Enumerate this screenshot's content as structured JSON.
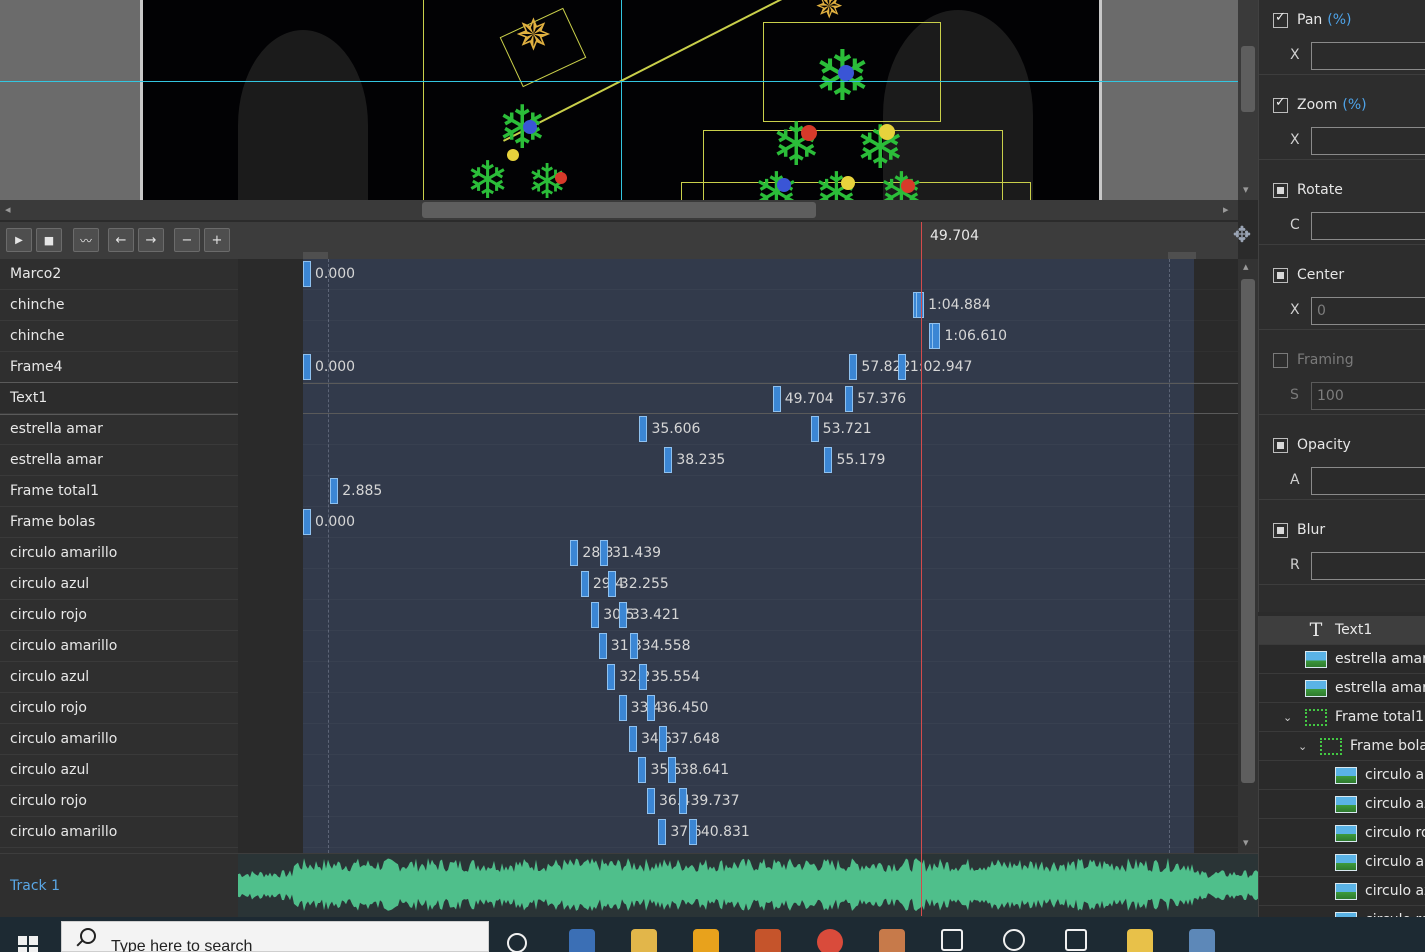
{
  "timeline": {
    "current_time": "49.704",
    "toolbar": {
      "play": "▶",
      "stop": "■",
      "waveform": "〰",
      "prev": "←",
      "next": "→",
      "zoom_out": "−",
      "zoom_in": "+"
    },
    "rows": [
      {
        "label": "Marco2",
        "keys": [
          {
            "t": 0.0,
            "text": "0.000"
          }
        ]
      },
      {
        "label": "chinche",
        "keys": [
          {
            "t": 64.5,
            "text": ""
          },
          {
            "t": 64.884,
            "text": "1:04.884"
          }
        ]
      },
      {
        "label": "chinche",
        "keys": [
          {
            "t": 66.2,
            "text": ""
          },
          {
            "t": 66.61,
            "text": "1:06.610"
          }
        ]
      },
      {
        "label": "Frame4",
        "keys": [
          {
            "t": 0.0,
            "text": "0.000"
          },
          {
            "t": 57.822,
            "text": "57.822"
          },
          {
            "t": 62.947,
            "text": "1:02.947"
          }
        ]
      },
      {
        "label": "Text1",
        "selected": true,
        "keys": [
          {
            "t": 49.704,
            "text": "49.704"
          },
          {
            "t": 57.376,
            "text": "57.376"
          }
        ]
      },
      {
        "label": "estrella amar",
        "keys": [
          {
            "t": 35.606,
            "text": "35.606"
          },
          {
            "t": 53.721,
            "text": "53.721"
          }
        ]
      },
      {
        "label": "estrella amar",
        "keys": [
          {
            "t": 38.235,
            "text": "38.235"
          },
          {
            "t": 55.179,
            "text": "55.179"
          }
        ]
      },
      {
        "label": "Frame total1",
        "keys": [
          {
            "t": 2.885,
            "text": "2.885"
          }
        ]
      },
      {
        "label": "Frame bolas",
        "keys": [
          {
            "t": 0.0,
            "text": "0.000"
          }
        ]
      },
      {
        "label": "circulo amarillo",
        "keys": [
          {
            "t": 28.3,
            "text": "28.3"
          },
          {
            "t": 31.439,
            "text": "31.439"
          }
        ]
      },
      {
        "label": "circulo azul",
        "keys": [
          {
            "t": 29.4,
            "text": "29.4"
          },
          {
            "t": 32.255,
            "text": "32.255"
          }
        ]
      },
      {
        "label": "circulo rojo",
        "keys": [
          {
            "t": 30.5,
            "text": "30.5"
          },
          {
            "t": 33.421,
            "text": "33.421"
          }
        ]
      },
      {
        "label": "circulo amarillo",
        "keys": [
          {
            "t": 31.3,
            "text": "31.3"
          },
          {
            "t": 34.558,
            "text": "34.558"
          }
        ]
      },
      {
        "label": "circulo azul",
        "keys": [
          {
            "t": 32.2,
            "text": "32.2"
          },
          {
            "t": 35.554,
            "text": "35.554"
          }
        ]
      },
      {
        "label": "circulo rojo",
        "keys": [
          {
            "t": 33.4,
            "text": "33.4"
          },
          {
            "t": 36.45,
            "text": "36.450"
          }
        ]
      },
      {
        "label": "circulo amarillo",
        "keys": [
          {
            "t": 34.5,
            "text": "34.5"
          },
          {
            "t": 37.648,
            "text": "37.648"
          }
        ]
      },
      {
        "label": "circulo azul",
        "keys": [
          {
            "t": 35.5,
            "text": "35.5"
          },
          {
            "t": 38.641,
            "text": "38.641"
          }
        ]
      },
      {
        "label": "circulo rojo",
        "keys": [
          {
            "t": 36.4,
            "text": "36.4"
          },
          {
            "t": 39.737,
            "text": "39.737"
          }
        ]
      },
      {
        "label": "circulo amarillo",
        "keys": [
          {
            "t": 37.6,
            "text": "37.6"
          },
          {
            "t": 40.831,
            "text": "40.831"
          }
        ]
      }
    ]
  },
  "audio": {
    "label": "Track 1",
    "color": "#4fbf8b"
  },
  "properties": [
    {
      "name": "Pan",
      "unit": "(%)",
      "state": "checked",
      "field_label": "X",
      "value": "",
      "disabled": false
    },
    {
      "name": "Zoom",
      "unit": "(%)",
      "state": "checked",
      "field_label": "X",
      "value": "",
      "disabled": false
    },
    {
      "name": "Rotate",
      "unit": "",
      "state": "square",
      "field_label": "C",
      "value": "",
      "disabled": false
    },
    {
      "name": "Center",
      "unit": "",
      "state": "square",
      "field_label": "X",
      "value": "0",
      "disabled": false
    },
    {
      "name": "Framing",
      "unit": "",
      "state": "empty",
      "field_label": "S",
      "value": "100",
      "disabled": true
    },
    {
      "name": "Opacity",
      "unit": "",
      "state": "square",
      "field_label": "A",
      "value": "",
      "disabled": false
    },
    {
      "name": "Blur",
      "unit": "",
      "state": "square",
      "field_label": "R",
      "value": "",
      "disabled": false
    }
  ],
  "layers": [
    {
      "label": "Text1",
      "icon": "text",
      "indent": 0,
      "selected": true
    },
    {
      "label": "estrella amar",
      "icon": "image",
      "indent": 0
    },
    {
      "label": "estrella amar",
      "icon": "image",
      "indent": 0
    },
    {
      "label": "Frame total1",
      "icon": "frame",
      "indent": 0,
      "expanded": true
    },
    {
      "label": "Frame bola",
      "icon": "frame",
      "indent": 1,
      "expanded": true
    },
    {
      "label": "circulo ar",
      "icon": "image",
      "indent": 2
    },
    {
      "label": "circulo az",
      "icon": "image",
      "indent": 2
    },
    {
      "label": "circulo ro",
      "icon": "image",
      "indent": 2
    },
    {
      "label": "circulo ar",
      "icon": "image",
      "indent": 2
    },
    {
      "label": "circulo az",
      "icon": "image",
      "indent": 2
    },
    {
      "label": "circulo ro",
      "icon": "image",
      "indent": 2
    }
  ],
  "taskbar": {
    "search_placeholder": "Type here to search",
    "apps": [
      "cortana-icon",
      "store-icon",
      "file-explorer-icon",
      "avast-icon",
      "glove-icon",
      "chrome-icon",
      "paint-icon",
      "brightness-icon",
      "alarm-clock-icon",
      "calendar-icon",
      "folder-icon",
      "slideshow-app-icon"
    ]
  }
}
